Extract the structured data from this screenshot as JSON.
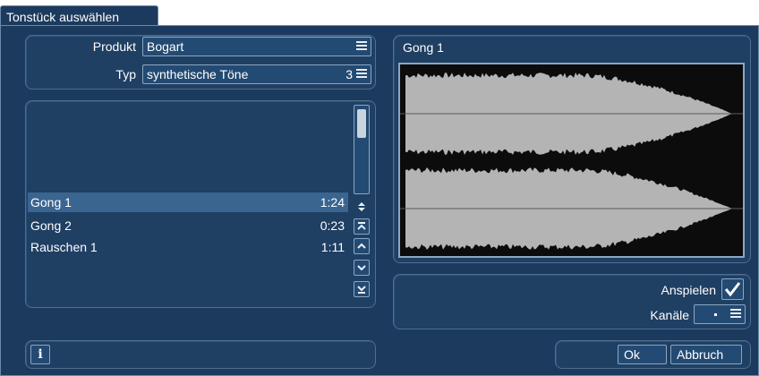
{
  "dialog": {
    "title": "Tonstück auswählen"
  },
  "product": {
    "label": "Produkt",
    "value": "Bogart"
  },
  "type": {
    "label": "Typ",
    "value": "synthetische Töne",
    "count": "3"
  },
  "tracks": [
    {
      "name": "Gong 1",
      "duration": "1:24",
      "selected": true
    },
    {
      "name": "Gong 2",
      "duration": "0:23",
      "selected": false
    },
    {
      "name": "Rauschen 1",
      "duration": "1:11",
      "selected": false
    }
  ],
  "preview": {
    "title": "Gong 1"
  },
  "options": {
    "play_label": "Anspielen",
    "play_checked": true,
    "channels_label": "Kanäle"
  },
  "footer": {
    "info_label": "i",
    "ok_label": "Ok",
    "cancel_label": "Abbruch"
  },
  "colors": {
    "background": "#1c3a5d",
    "selection": "#3a6591",
    "waveform": "#b4b4b4"
  }
}
